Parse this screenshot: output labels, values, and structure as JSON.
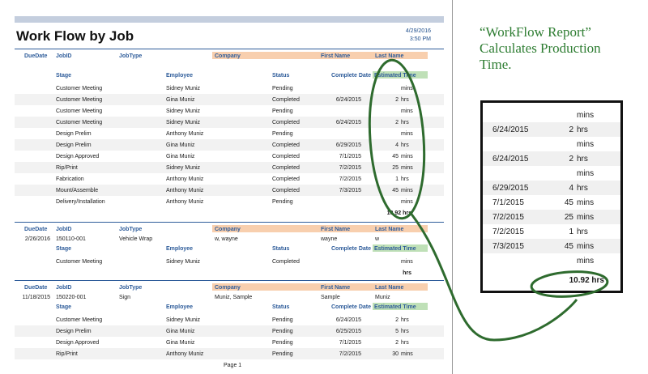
{
  "report": {
    "title": "Work Flow by Job",
    "date": "4/29/2016",
    "time": "3:50 PM",
    "page": "Page 1",
    "col_headers": {
      "due": "DueDate",
      "jobid": "JobID",
      "jobtype": "JobType",
      "company": "Company",
      "first": "First Name",
      "last": "Last Name",
      "stage": "Stage",
      "employee": "Employee",
      "status": "Status",
      "complete": "Complete Date",
      "est": "Estimated Time"
    },
    "job1": {
      "due": "",
      "jobid": "",
      "jobtype": "",
      "company": "",
      "first": "",
      "last": "",
      "total": "10.92  hrs",
      "rows": [
        {
          "stage": "Customer Meeting",
          "employee": "Sidney Muniz",
          "status": "Pending",
          "date": "",
          "num": "",
          "unit": "mins"
        },
        {
          "stage": "Customer Meeting",
          "employee": "Gina Muniz",
          "status": "Completed",
          "date": "6/24/2015",
          "num": "2",
          "unit": "hrs"
        },
        {
          "stage": "Customer Meeting",
          "employee": "Sidney Muniz",
          "status": "Pending",
          "date": "",
          "num": "",
          "unit": "mins"
        },
        {
          "stage": "Customer Meeting",
          "employee": "Sidney Muniz",
          "status": "Completed",
          "date": "6/24/2015",
          "num": "2",
          "unit": "hrs"
        },
        {
          "stage": "Design Prelim",
          "employee": "Anthony Muniz",
          "status": "Pending",
          "date": "",
          "num": "",
          "unit": "mins"
        },
        {
          "stage": "Design Prelim",
          "employee": "Gina Muniz",
          "status": "Completed",
          "date": "6/29/2015",
          "num": "4",
          "unit": "hrs"
        },
        {
          "stage": "Design Approved",
          "employee": "Gina Muniz",
          "status": "Completed",
          "date": "7/1/2015",
          "num": "45",
          "unit": "mins"
        },
        {
          "stage": "Rip/Print",
          "employee": "Sidney Muniz",
          "status": "Completed",
          "date": "7/2/2015",
          "num": "25",
          "unit": "mins"
        },
        {
          "stage": "Fabrication",
          "employee": "Anthony Muniz",
          "status": "Completed",
          "date": "7/2/2015",
          "num": "1",
          "unit": "hrs"
        },
        {
          "stage": "Mount/Assemble",
          "employee": "Anthony Muniz",
          "status": "Completed",
          "date": "7/3/2015",
          "num": "45",
          "unit": "mins"
        },
        {
          "stage": "Delivery/Installation",
          "employee": "Anthony Muniz",
          "status": "Pending",
          "date": "",
          "num": "",
          "unit": "mins"
        }
      ]
    },
    "job2": {
      "due": "2/26/2016",
      "jobid": "150110-001",
      "jobtype": "Vehicle Wrap",
      "company": "w, wayne",
      "first": "wayne",
      "last": "w",
      "total": "hrs",
      "rows": [
        {
          "stage": "Customer Meeting",
          "employee": "Sidney Muniz",
          "status": "Completed",
          "date": "",
          "num": "",
          "unit": "mins"
        }
      ]
    },
    "job3": {
      "due": "11/18/2015",
      "jobid": "150220-001",
      "jobtype": "Sign",
      "company": "Muniz, Sample",
      "first": "Sample",
      "last": "Muniz",
      "rows": [
        {
          "stage": "Customer Meeting",
          "employee": "Sidney Muniz",
          "status": "Pending",
          "date": "6/24/2015",
          "num": "2",
          "unit": "hrs"
        },
        {
          "stage": "Design Prelim",
          "employee": "Gina Muniz",
          "status": "Pending",
          "date": "6/25/2015",
          "num": "5",
          "unit": "hrs"
        },
        {
          "stage": "Design Approved",
          "employee": "Gina Muniz",
          "status": "Pending",
          "date": "7/1/2015",
          "num": "2",
          "unit": "hrs"
        },
        {
          "stage": "Rip/Print",
          "employee": "Anthony Muniz",
          "status": "Pending",
          "date": "7/2/2015",
          "num": "30",
          "unit": "mins"
        }
      ]
    }
  },
  "callout": {
    "line1": "“WorkFlow Report”",
    "line2": "Calculates Production",
    "line3": "Time.",
    "color": "#2e7d32"
  },
  "zoom": {
    "rows": [
      {
        "date": "",
        "num": "",
        "unit": "mins"
      },
      {
        "date": "6/24/2015",
        "num": "2",
        "unit": "hrs"
      },
      {
        "date": "",
        "num": "",
        "unit": "mins"
      },
      {
        "date": "6/24/2015",
        "num": "2",
        "unit": "hrs"
      },
      {
        "date": "",
        "num": "",
        "unit": "mins"
      },
      {
        "date": "6/29/2015",
        "num": "4",
        "unit": "hrs"
      },
      {
        "date": "7/1/2015",
        "num": "45",
        "unit": "mins"
      },
      {
        "date": "7/2/2015",
        "num": "25",
        "unit": "mins"
      },
      {
        "date": "7/2/2015",
        "num": "1",
        "unit": "hrs"
      },
      {
        "date": "7/3/2015",
        "num": "45",
        "unit": "mins"
      },
      {
        "date": "",
        "num": "",
        "unit": "mins"
      }
    ],
    "total": "10.92  hrs"
  }
}
